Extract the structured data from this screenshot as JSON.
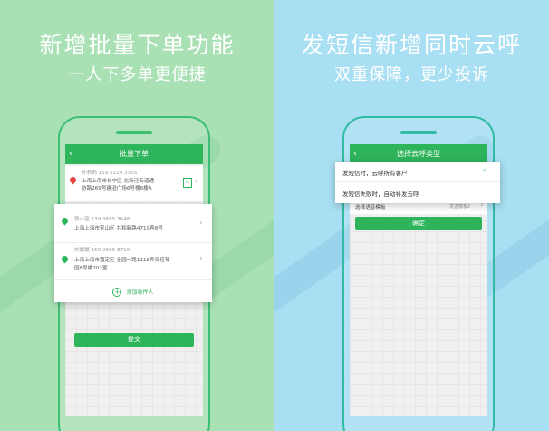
{
  "left": {
    "headline": "新增批量下单功能",
    "subheadline": "一人下多单更便捷",
    "screen": {
      "title": "批量下单",
      "sender": {
        "name_phone": "孙莉莉  159 5114 3305",
        "address_line1": "上海上海市长宁区 北新泾街道通",
        "address_line2": "协路269号建滔广场6号楼6楼A"
      },
      "recipients": [
        {
          "name_phone": "铁小宝  139 3695 3648",
          "address_line1": "上海上海市宝山区 共和新路4719弄8号",
          "address_line2": ""
        },
        {
          "name_phone": "刘媛媛  159 2605 8719",
          "address_line1": "上海上海市嘉定区 金园一路1118弄双佳琴",
          "address_line2": "园8号楼202室"
        }
      ],
      "add_recipient": "添加收件人",
      "submit": "提交"
    }
  },
  "right": {
    "headline": "发短信新增同时云呼",
    "subheadline": "双重保障，更少投诉",
    "screen": {
      "title": "选择云呼类型",
      "options": [
        {
          "label": "发短信时，云呼所有客户",
          "checked": true
        },
        {
          "label": "发短信失败时，自动补发云呼",
          "checked": false
        }
      ],
      "template_label": "选择语音模板",
      "template_value": "发送模板2",
      "confirm": "确定"
    }
  },
  "colors": {
    "left_bg": "#a9e1b5",
    "right_bg": "#a8dff2",
    "accent_green": "#2eb45b",
    "pin_red": "#e2463c",
    "pin_green": "#2eb45b"
  }
}
